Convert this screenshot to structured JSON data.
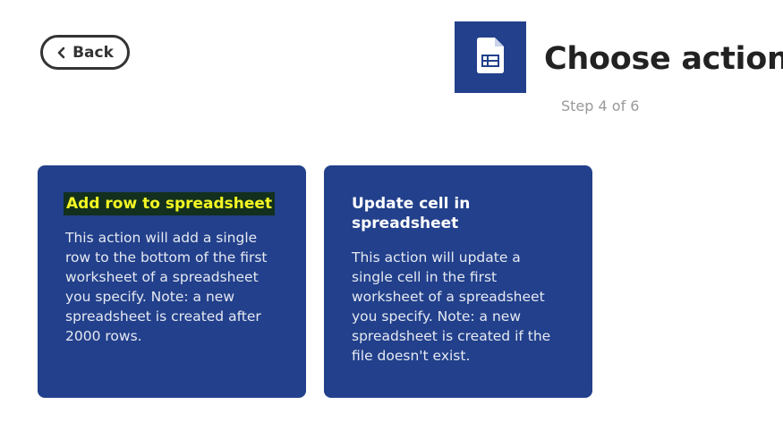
{
  "nav": {
    "back_label": "Back"
  },
  "header": {
    "service_icon": "google-sheets-icon",
    "title": "Choose action",
    "step": "Step 4 of 6",
    "tile_color": "#22408b"
  },
  "actions": [
    {
      "title": "Add row to spreadsheet",
      "description": "This action will add a single row to the bottom of the first worksheet of a spreadsheet you specify. Note: a new spreadsheet is created after 2000 rows.",
      "highlighted": true
    },
    {
      "title": "Update cell in spreadsheet",
      "description": "This action will update a single cell in the first worksheet of a spreadsheet you specify. Note: a new spreadsheet is created if the file doesn't exist.",
      "highlighted": false
    }
  ],
  "colors": {
    "card_background": "#22408b",
    "highlight_text": "#f5f723",
    "highlight_background": "#12301d"
  }
}
